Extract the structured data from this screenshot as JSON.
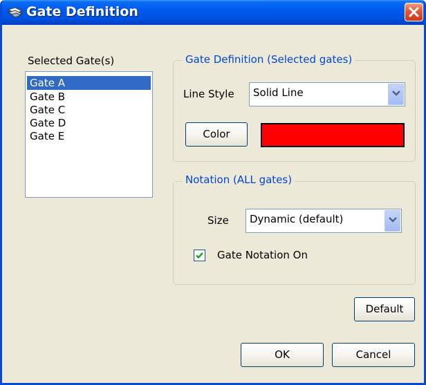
{
  "window": {
    "title": "Gate Definition"
  },
  "gates": {
    "label": "Selected Gate(s)",
    "items": [
      "Gate A",
      "Gate B",
      "Gate C",
      "Gate D",
      "Gate E"
    ],
    "selected": "Gate A"
  },
  "definition": {
    "group_title": "Gate Definition (Selected gates)",
    "line_style_label": "Line Style",
    "line_style_value": "Solid Line",
    "color_button": "Color",
    "color_value": "#ff0000"
  },
  "notation": {
    "group_title": "Notation (ALL gates)",
    "size_label": "Size",
    "size_value": "Dynamic (default)",
    "checkbox_label": "Gate Notation On",
    "checkbox_checked": true
  },
  "buttons": {
    "default": "Default",
    "ok": "OK",
    "cancel": "Cancel"
  },
  "icons": {
    "app": "gate-app-icon",
    "close": "close-icon",
    "dropdown": "chevron-down-icon",
    "check": "checkmark-icon"
  },
  "colors": {
    "title_bar": "#0054e3",
    "selection": "#316ac5",
    "group_title": "#0046d5"
  }
}
